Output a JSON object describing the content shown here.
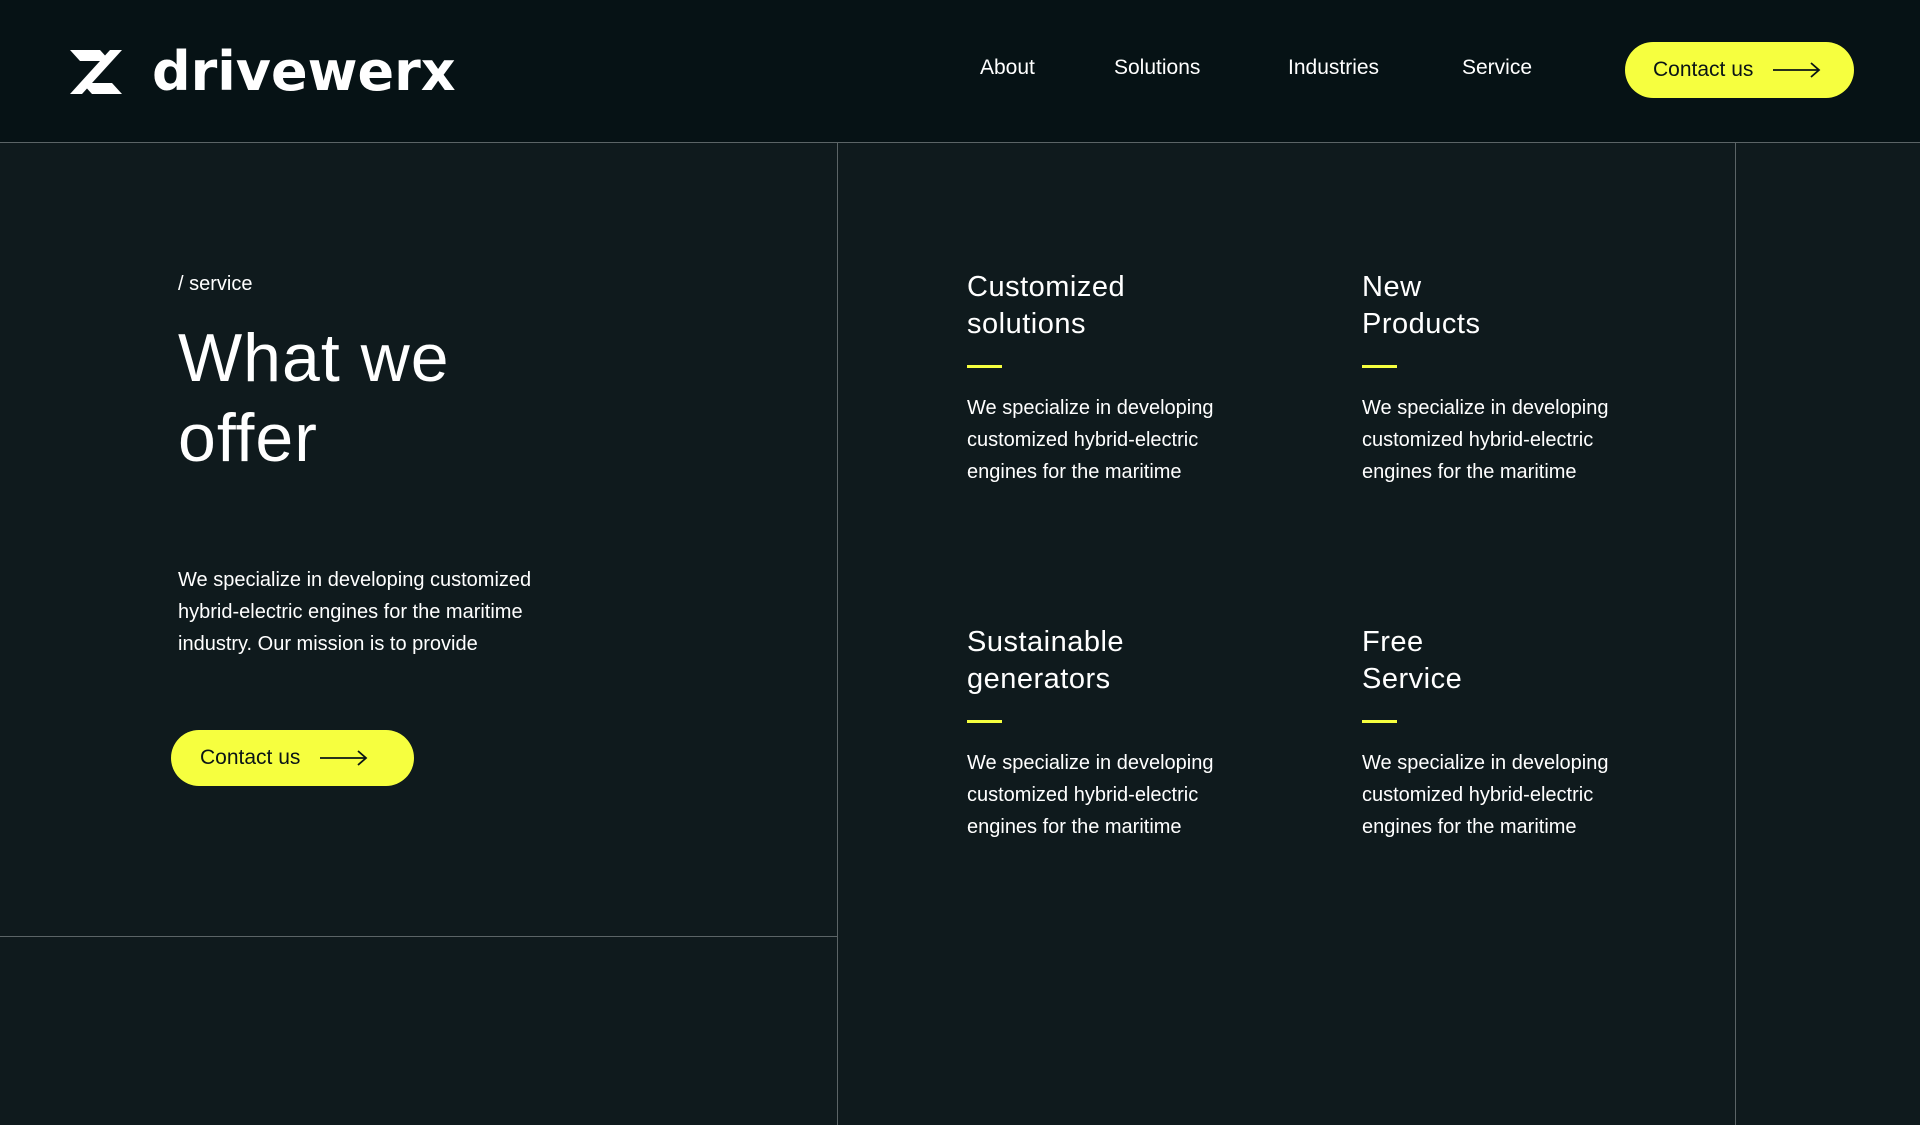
{
  "header": {
    "brand": "drivewerx",
    "nav": [
      {
        "label": "About"
      },
      {
        "label": "Solutions"
      },
      {
        "label": "Industries"
      },
      {
        "label": "Service"
      }
    ],
    "contact_label": "Contact us"
  },
  "hero": {
    "eyebrow": "/ service",
    "title_line1": "What we",
    "title_line2": "offer",
    "text_line1": "We specialize in developing customized",
    "text_line2": "hybrid-electric engines for the maritime",
    "text_line3": "industry. Our mission is to provide",
    "contact_label": "Contact us"
  },
  "cards": [
    {
      "title_line1": "Customized",
      "title_line2": "solutions",
      "text_line1": "We specialize in developing",
      "text_line2": "customized hybrid-electric",
      "text_line3": "engines for the maritime"
    },
    {
      "title_line1": "New",
      "title_line2": "Products",
      "text_line1": "We specialize in developing",
      "text_line2": "customized hybrid-electric",
      "text_line3": "engines for the maritime"
    },
    {
      "title_line1": "Sustainable",
      "title_line2": "generators",
      "text_line1": "We specialize in developing",
      "text_line2": "customized hybrid-electric",
      "text_line3": "engines for the maritime"
    },
    {
      "title_line1": "Free",
      "title_line2": "Service",
      "text_line1": "We specialize in developing",
      "text_line2": "customized hybrid-electric",
      "text_line3": "engines for the maritime"
    }
  ],
  "colors": {
    "background": "#0f1a1d",
    "header_background": "#061215",
    "accent": "#f6ff3f",
    "divider": "#5b6466",
    "text": "#ffffff"
  },
  "icons": {
    "logo": "drivewerx-logo-icon",
    "arrow": "arrow-right-icon"
  }
}
